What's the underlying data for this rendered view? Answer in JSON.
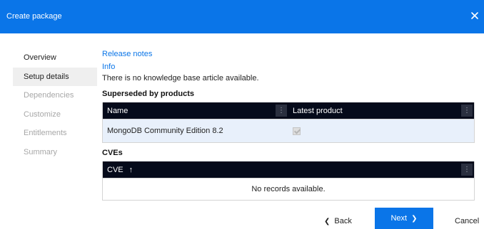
{
  "dialog": {
    "title": "Create package",
    "close_icon": "close-icon"
  },
  "nav": {
    "items": [
      {
        "label": "Overview",
        "state": "enabled"
      },
      {
        "label": "Setup details",
        "state": "active"
      },
      {
        "label": "Dependencies",
        "state": "disabled"
      },
      {
        "label": "Customize",
        "state": "disabled"
      },
      {
        "label": "Entitlements",
        "state": "disabled"
      },
      {
        "label": "Summary",
        "state": "disabled"
      }
    ]
  },
  "details": {
    "release_notes_link": "Release notes",
    "info_link": "Info",
    "kb_message": "There is no knowledge base article available."
  },
  "superseded": {
    "title": "Superseded by products",
    "columns": [
      "Name",
      "Latest product"
    ],
    "rows": [
      {
        "name": "MongoDB Community Edition 8.2",
        "latest_product": true
      }
    ]
  },
  "cves": {
    "title": "CVEs",
    "column": "CVE",
    "sort_indicator": "↑",
    "empty_message": "No records available."
  },
  "footer": {
    "back_label": "Back",
    "next_label": "Next",
    "cancel_label": "Cancel"
  },
  "colors": {
    "accent": "#0a75e8",
    "grid_header": "#050a1a",
    "selected_row": "#e8f0fb"
  }
}
